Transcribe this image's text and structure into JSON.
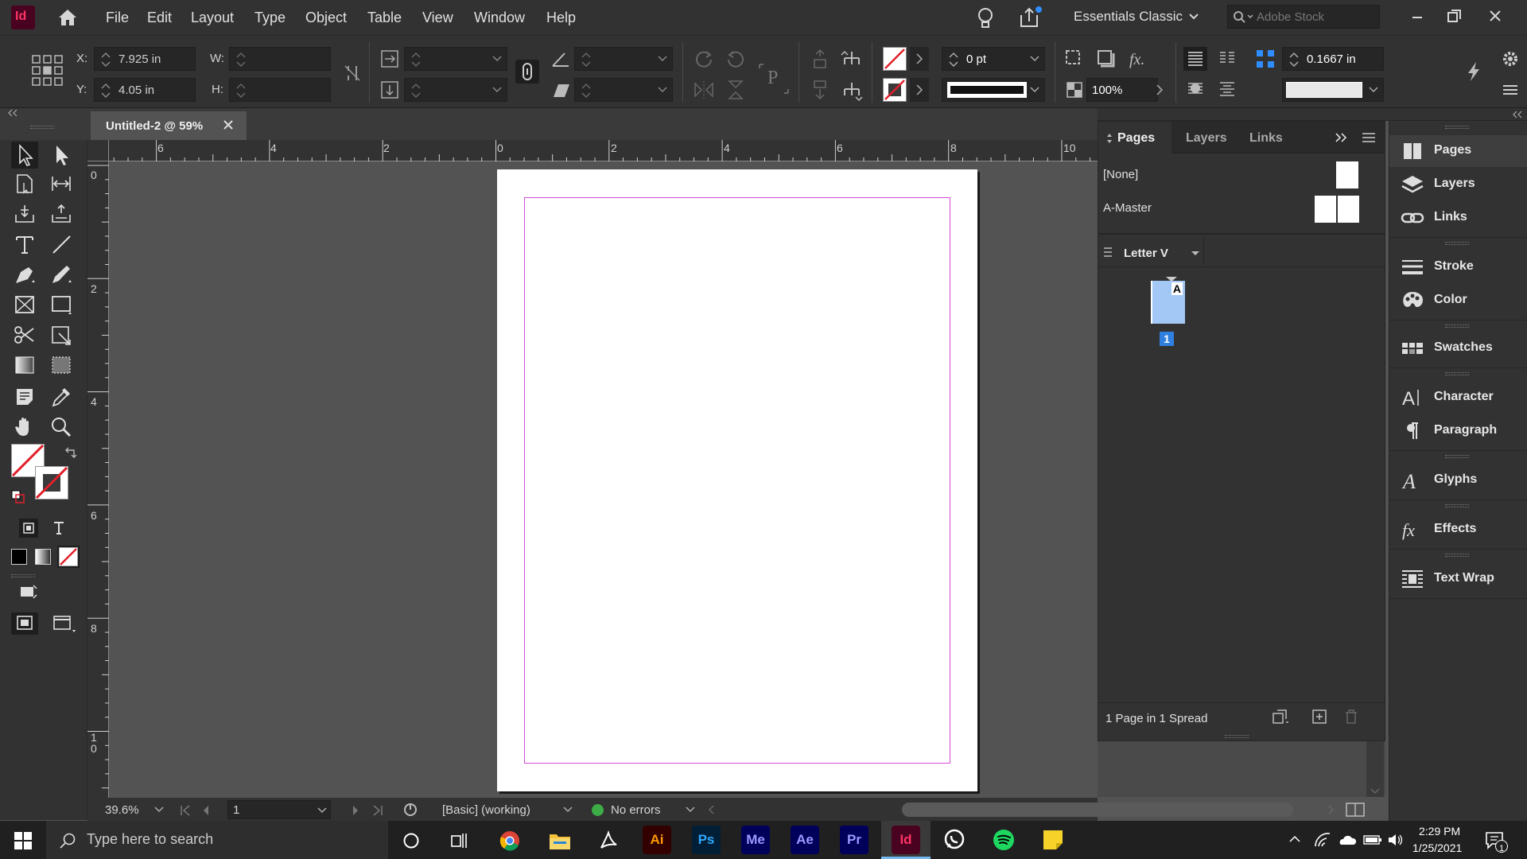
{
  "menubar": {
    "app_badge": "Id",
    "menus": [
      "File",
      "Edit",
      "Layout",
      "Type",
      "Object",
      "Table",
      "View",
      "Window",
      "Help"
    ],
    "workspace": "Essentials Classic",
    "search_placeholder": "Adobe Stock"
  },
  "control": {
    "x_label": "X:",
    "x_value": "7.925 in",
    "y_label": "Y:",
    "y_value": "4.05 in",
    "w_label": "W:",
    "h_label": "H:",
    "stroke_weight": "0 pt",
    "opacity": "100%",
    "gap_value": "0.1667 in"
  },
  "document": {
    "tab_title": "Untitled-2 @ 59%"
  },
  "ruler": {
    "h_labels": [
      "6",
      "4",
      "2",
      "0",
      "2",
      "4",
      "6",
      "8",
      "10"
    ],
    "v_labels": [
      "0",
      "2",
      "4",
      "6",
      "8",
      "1\n0"
    ]
  },
  "status": {
    "zoom": "39.6%",
    "page": "1",
    "preflight_profile": "[Basic] (working)",
    "errors": "No errors"
  },
  "pages_panel": {
    "tabs": [
      "Pages",
      "Layers",
      "Links"
    ],
    "none_master": "[None]",
    "a_master": "A-Master",
    "page_size": "Letter V",
    "master_letter": "A",
    "page_number": "1",
    "footer": "1 Page in 1 Spread"
  },
  "dock": {
    "items": [
      "Pages",
      "Layers",
      "Links",
      "Stroke",
      "Color",
      "Swatches",
      "Character",
      "Paragraph",
      "Glyphs",
      "Effects",
      "Text Wrap"
    ]
  },
  "taskbar": {
    "search_placeholder": "Type here to search",
    "apps": [
      "Ai",
      "Ps",
      "Me",
      "Ae",
      "Pr",
      "Id"
    ],
    "time": "2:29 PM",
    "date": "1/25/2021",
    "notification_count": "1"
  },
  "colors": {
    "indesign": "#ff3366",
    "illustrator": "#ff9a00",
    "photoshop": "#31a8ff",
    "media_encoder": "#9999ff",
    "after_effects": "#9999ff",
    "premiere": "#9999ff",
    "margin_guide": "#d64ad6",
    "selection_blue": "#a3c8f5"
  }
}
